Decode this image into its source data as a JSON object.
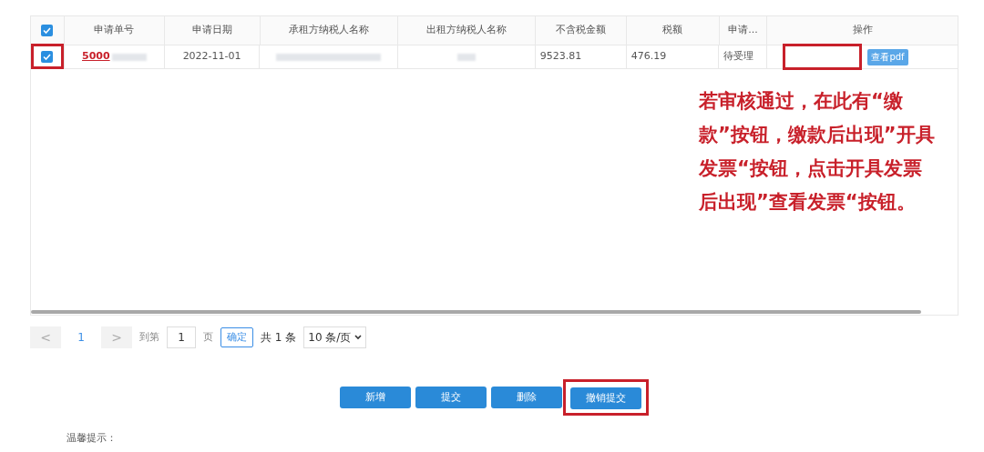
{
  "table": {
    "header_checked": true,
    "columns": [
      "申请单号",
      "申请日期",
      "承租方纳税人名称",
      "出租方纳税人名称",
      "不含税金额",
      "税额",
      "申请...",
      "操作"
    ],
    "rows": [
      {
        "checked": true,
        "marked": true,
        "number": "5000",
        "date": "2022-11-01",
        "amount": "9523.81",
        "tax": "476.19",
        "status": "待受理",
        "action_slot_marked": true,
        "action": "查看pdf"
      }
    ]
  },
  "annotation": "若审核通过，在此有“缴款”按钮，缴款后出现”开具发票“按钮，点击开具发票后出现”查看发票“按钮。",
  "pagination": {
    "prev": "<",
    "page": "1",
    "next": ">",
    "goto_label": "到第",
    "goto_value": "1",
    "page_unit": "页",
    "confirm": "确定",
    "total": "共 1 条",
    "page_size": "10 条/页"
  },
  "buttons": [
    {
      "label": "新增",
      "marked": false
    },
    {
      "label": "提交",
      "marked": false
    },
    {
      "label": "删除",
      "marked": false
    },
    {
      "label": "撤销提交",
      "marked": true
    }
  ],
  "tip_title": "温馨提示："
}
